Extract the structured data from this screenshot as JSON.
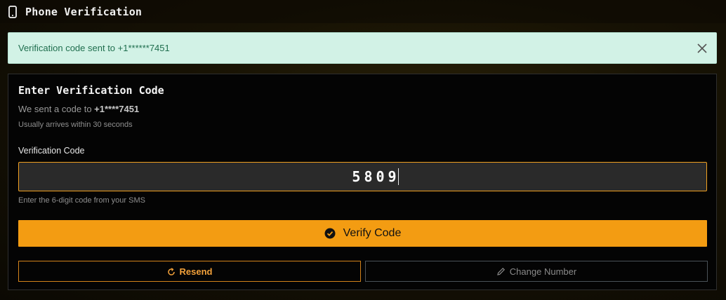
{
  "header": {
    "title": "Phone Verification",
    "icon": "smartphone-icon"
  },
  "alert": {
    "message": "Verification code sent to +1******7451",
    "close_icon": "close-icon"
  },
  "card": {
    "heading": "Enter Verification Code",
    "sent_prefix": "We sent a code to ",
    "sent_number": "+1****7451",
    "arrives_note": "Usually arrives within 30 seconds",
    "field_label": "Verification Code",
    "code_value": "5809",
    "hint": "Enter the 6-digit code from your SMS",
    "verify_label": "Verify Code",
    "verify_icon": "check-circle-icon",
    "resend_label": "Resend",
    "resend_icon": "refresh-icon",
    "change_label": "Change Number",
    "change_icon": "pencil-icon"
  },
  "colors": {
    "accent": "#f39c12",
    "alert_bg": "#d2f2e6",
    "alert_text": "#1f6e4e",
    "background": "#0b0903"
  }
}
